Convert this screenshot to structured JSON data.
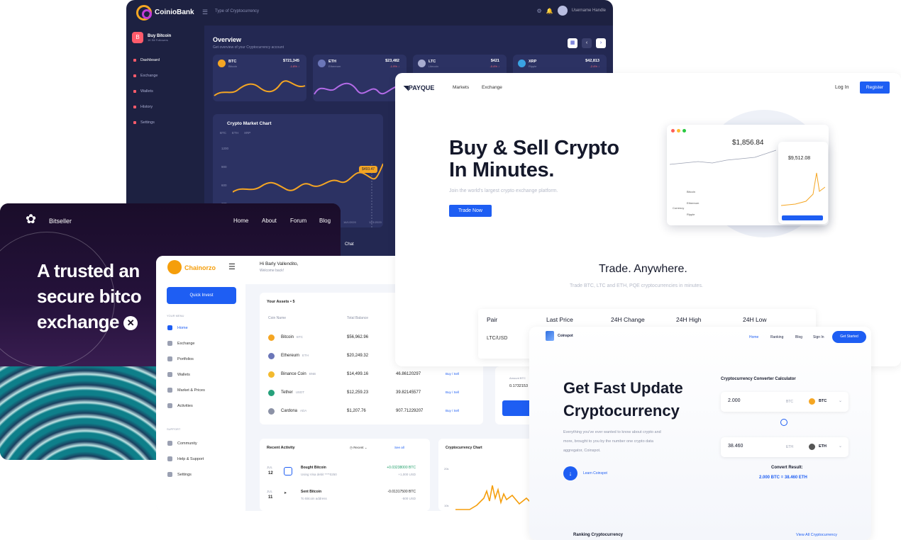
{
  "coinio": {
    "brand": "CoinioBank",
    "menu_icon": "menu-icon",
    "search_placeholder": "Type of Cryptocurrency",
    "user_name": "Username Handle",
    "promo_title": "Buy Bitcoin",
    "promo_sub": "1K Bit Followers",
    "nav": [
      "Dashboard",
      "Exchange",
      "Wallets",
      "History",
      "Settings"
    ],
    "overview_title": "Overview",
    "overview_sub": "Get overview of your Cryptocurrency account",
    "tickers": [
      {
        "sym": "BTC",
        "name": "Bitcoin",
        "price": "$721,345",
        "change": "-1.8% ↓",
        "color": "#f5a623"
      },
      {
        "sym": "ETH",
        "name": "Ethereum",
        "price": "$23,482",
        "change": "-1.9% ↓",
        "color": "#6b76b8"
      },
      {
        "sym": "LTC",
        "name": "Litecoin",
        "price": "$421",
        "change": "-0.4% ↓",
        "color": "#a8acd0"
      },
      {
        "sym": "XRP",
        "name": "Ripple",
        "price": "$42,813",
        "change": "-2.4% ↓",
        "color": "#3aa3e3"
      }
    ],
    "chart_title": "Crypto Market Chart",
    "chart_legend": [
      "BTC",
      "ETH",
      "XRP"
    ],
    "y_ticks": [
      "1200",
      "900",
      "600",
      "300"
    ],
    "tag": "$493.47",
    "dates": [
      "16/1/2020",
      "12/1/2020"
    ],
    "chat_label": "Chat"
  },
  "bitseller": {
    "brand": "Bitseller",
    "nav": [
      "Home",
      "About",
      "Forum",
      "Blog"
    ],
    "headline": [
      "A trusted an",
      "secure bitco",
      "exchange"
    ]
  },
  "chainorzo": {
    "brand": "Chainorzo",
    "quick_invest": "Quick Invest",
    "section_main": "YOUR MENU",
    "nav": [
      "Home",
      "Exchange",
      "Portfolios",
      "Wallets",
      "Market & Prices",
      "Activities"
    ],
    "section_support": "SUPPORT",
    "support_nav": [
      "Community",
      "Help & Support",
      "Settings"
    ],
    "greeting": "Hi Barly Vallendito,",
    "welcome": "Welcome back!",
    "assets_title": "Your Assets • 5",
    "col_coin": "Coin Name",
    "col_balance": "Total Balance",
    "assets": [
      {
        "name": "Bitcoin",
        "sym": "BTC",
        "balance": "$56,962.96",
        "amount": "",
        "action": "",
        "color": "#f5a623"
      },
      {
        "name": "Ethereum",
        "sym": "ETH",
        "balance": "$20,249.32",
        "amount": "",
        "action": "",
        "color": "#6b76b8"
      },
      {
        "name": "Binance Coin",
        "sym": "BNB",
        "balance": "$14,499.16",
        "amount": "46.86120297",
        "action": "Buy / Sell",
        "color": "#f3ba2f"
      },
      {
        "name": "Tether",
        "sym": "USDT",
        "balance": "$12,259.23",
        "amount": "39.82145577",
        "action": "Buy / Sell",
        "color": "#26a17b"
      },
      {
        "name": "Cardona",
        "sym": "ADA",
        "balance": "$1,207.76",
        "amount": "907.71229207",
        "action": "Buy / Sell",
        "color": "#8c92a6"
      }
    ],
    "recent_title": "Recent Activity",
    "recent_filter": "Recent",
    "see_all": "See all",
    "transactions": [
      {
        "month": "JUL",
        "day": "12",
        "title": "Bought Bitcoin",
        "sub": "Using Visa debit ****0250",
        "v1": "+0.03238000 BTC",
        "v2": "+1,000 USD",
        "v1color": "#22a06b"
      },
      {
        "month": "JUL",
        "day": "11",
        "title": "Sent Bitcoin",
        "sub": "To Bitcoin address",
        "v1": "-0.01317500 BTC",
        "v2": "-500 USD",
        "v1color": "#333333"
      }
    ],
    "chart_title": "Cryptocurrency Chart",
    "chart_y": [
      "20k",
      "10k"
    ],
    "amount_label": "Amount BTC",
    "amount_value": "0.1732153"
  },
  "payque": {
    "brand": "PAYQUE",
    "nav": [
      "Markets",
      "Exchange"
    ],
    "login": "Log In",
    "register": "Register",
    "headline": [
      "Buy & Sell Crypto",
      "In Minutes."
    ],
    "sub": "Join the world's largest crypto exchange platform.",
    "cta": "Trade Now",
    "mock_price": "$1,856.84",
    "phone_price": "$9,512.08",
    "mock_label": "Currency",
    "mock_rows": [
      "Bitcoin",
      "Ethereum",
      "Ripple"
    ],
    "section_title": "Trade. Anywhere.",
    "section_sub": "Trade BTC, LTC and ETH, PQE cryptocurrencies in minutes.",
    "table_headers": [
      "Pair",
      "Last Price",
      "24H Change",
      "24H High",
      "24H Low"
    ],
    "table_first_pair": "LTC/USD"
  },
  "coinspot": {
    "brand": "Coinspot",
    "nav": [
      "Home",
      "Ranking",
      "Blog",
      "Sign In"
    ],
    "get_started": "Get Started",
    "headline": [
      "Get Fast Update",
      "Cryptocurrency"
    ],
    "para": [
      "Everything you've ever wanted to know about crypto and",
      "more, brought to you by the number one crypto data",
      "aggregator, Coinspot."
    ],
    "learn": "Learn Coinspot",
    "conv_title": "Cryptocurrency Converter Calculator",
    "conv_rows": [
      {
        "value": "2.000",
        "unit": "BTC",
        "coin": "BTC",
        "color": "#f5a623"
      },
      {
        "value": "38.460",
        "unit": "ETH",
        "coin": "ETH",
        "color": "#555555"
      }
    ],
    "result_label": "Convert Result:",
    "result_value": "2.000 BTC = 38.460 ETH",
    "ranking": "Ranking Cryptocurrency",
    "view_all": "View All Cryptocurrency"
  }
}
